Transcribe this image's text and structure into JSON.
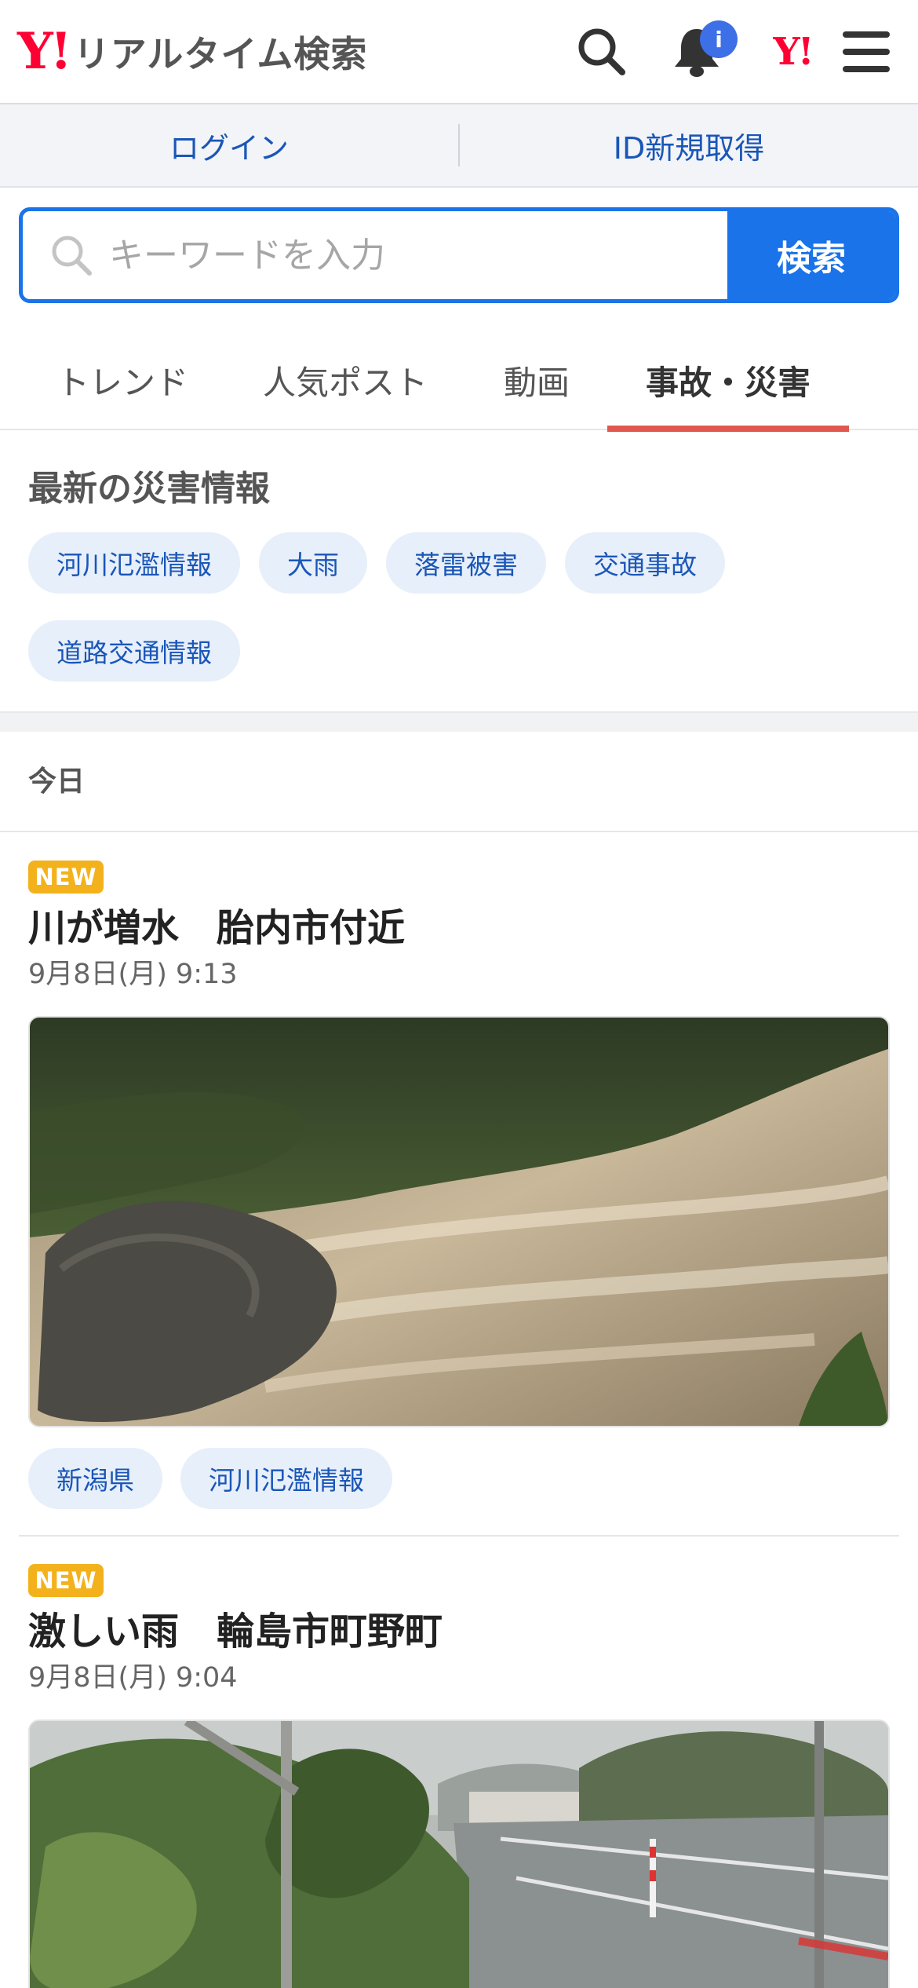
{
  "header": {
    "logo_y": "Y!",
    "logo_text": "リアルタイム検索",
    "notification_badge": "i",
    "yahoo_mark": "Y!"
  },
  "auth": {
    "login": "ログイン",
    "signup": "ID新規取得"
  },
  "search": {
    "placeholder": "キーワードを入力",
    "button": "検索"
  },
  "tabs": [
    {
      "label": "トレンド",
      "active": false
    },
    {
      "label": "人気ポスト",
      "active": false
    },
    {
      "label": "動画",
      "active": false
    },
    {
      "label": "事故・災害",
      "active": true
    }
  ],
  "disaster": {
    "title": "最新の災害情報",
    "chips": [
      "河川氾濫情報",
      "大雨",
      "落雷被害",
      "交通事故",
      "道路交通情報"
    ]
  },
  "feed": {
    "day_label": "今日",
    "articles": [
      {
        "badge": "NEW",
        "title": "川が増水　胎内市付近",
        "date": "9月8日(月) 9:13",
        "tags": [
          "新潟県",
          "河川氾濫情報"
        ]
      },
      {
        "badge": "NEW",
        "title": "激しい雨　輪島市町野町",
        "date": "9月8日(月) 9:04",
        "tags": []
      }
    ]
  },
  "colors": {
    "brand_red": "#ff0033",
    "accent_blue": "#1a73e8",
    "link_blue": "#1a56b8",
    "active_tab_underline": "#e0584d",
    "new_badge": "#f3b21b",
    "chip_bg": "#e7effa"
  }
}
